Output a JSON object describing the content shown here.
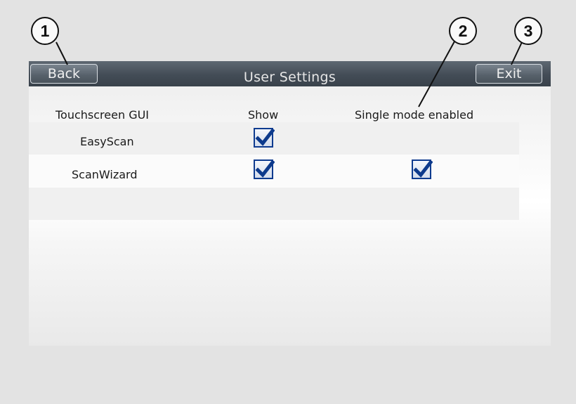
{
  "callouts": [
    "1",
    "2",
    "3"
  ],
  "header": {
    "title": "User Settings",
    "back_label": "Back",
    "exit_label": "Exit"
  },
  "table": {
    "columns": [
      "Touchscreen GUI",
      "Show",
      "Single mode enabled"
    ],
    "rows": [
      {
        "name": "EasyScan",
        "show": true,
        "single_mode": null
      },
      {
        "name": "ScanWizard",
        "show": true,
        "single_mode": true
      }
    ]
  },
  "colors": {
    "titlebar": "#434c56",
    "checkbox_border": "#0e3b8f",
    "check_mark": "#0d3a8c"
  },
  "icons": {
    "checked": "check-mark-icon"
  }
}
